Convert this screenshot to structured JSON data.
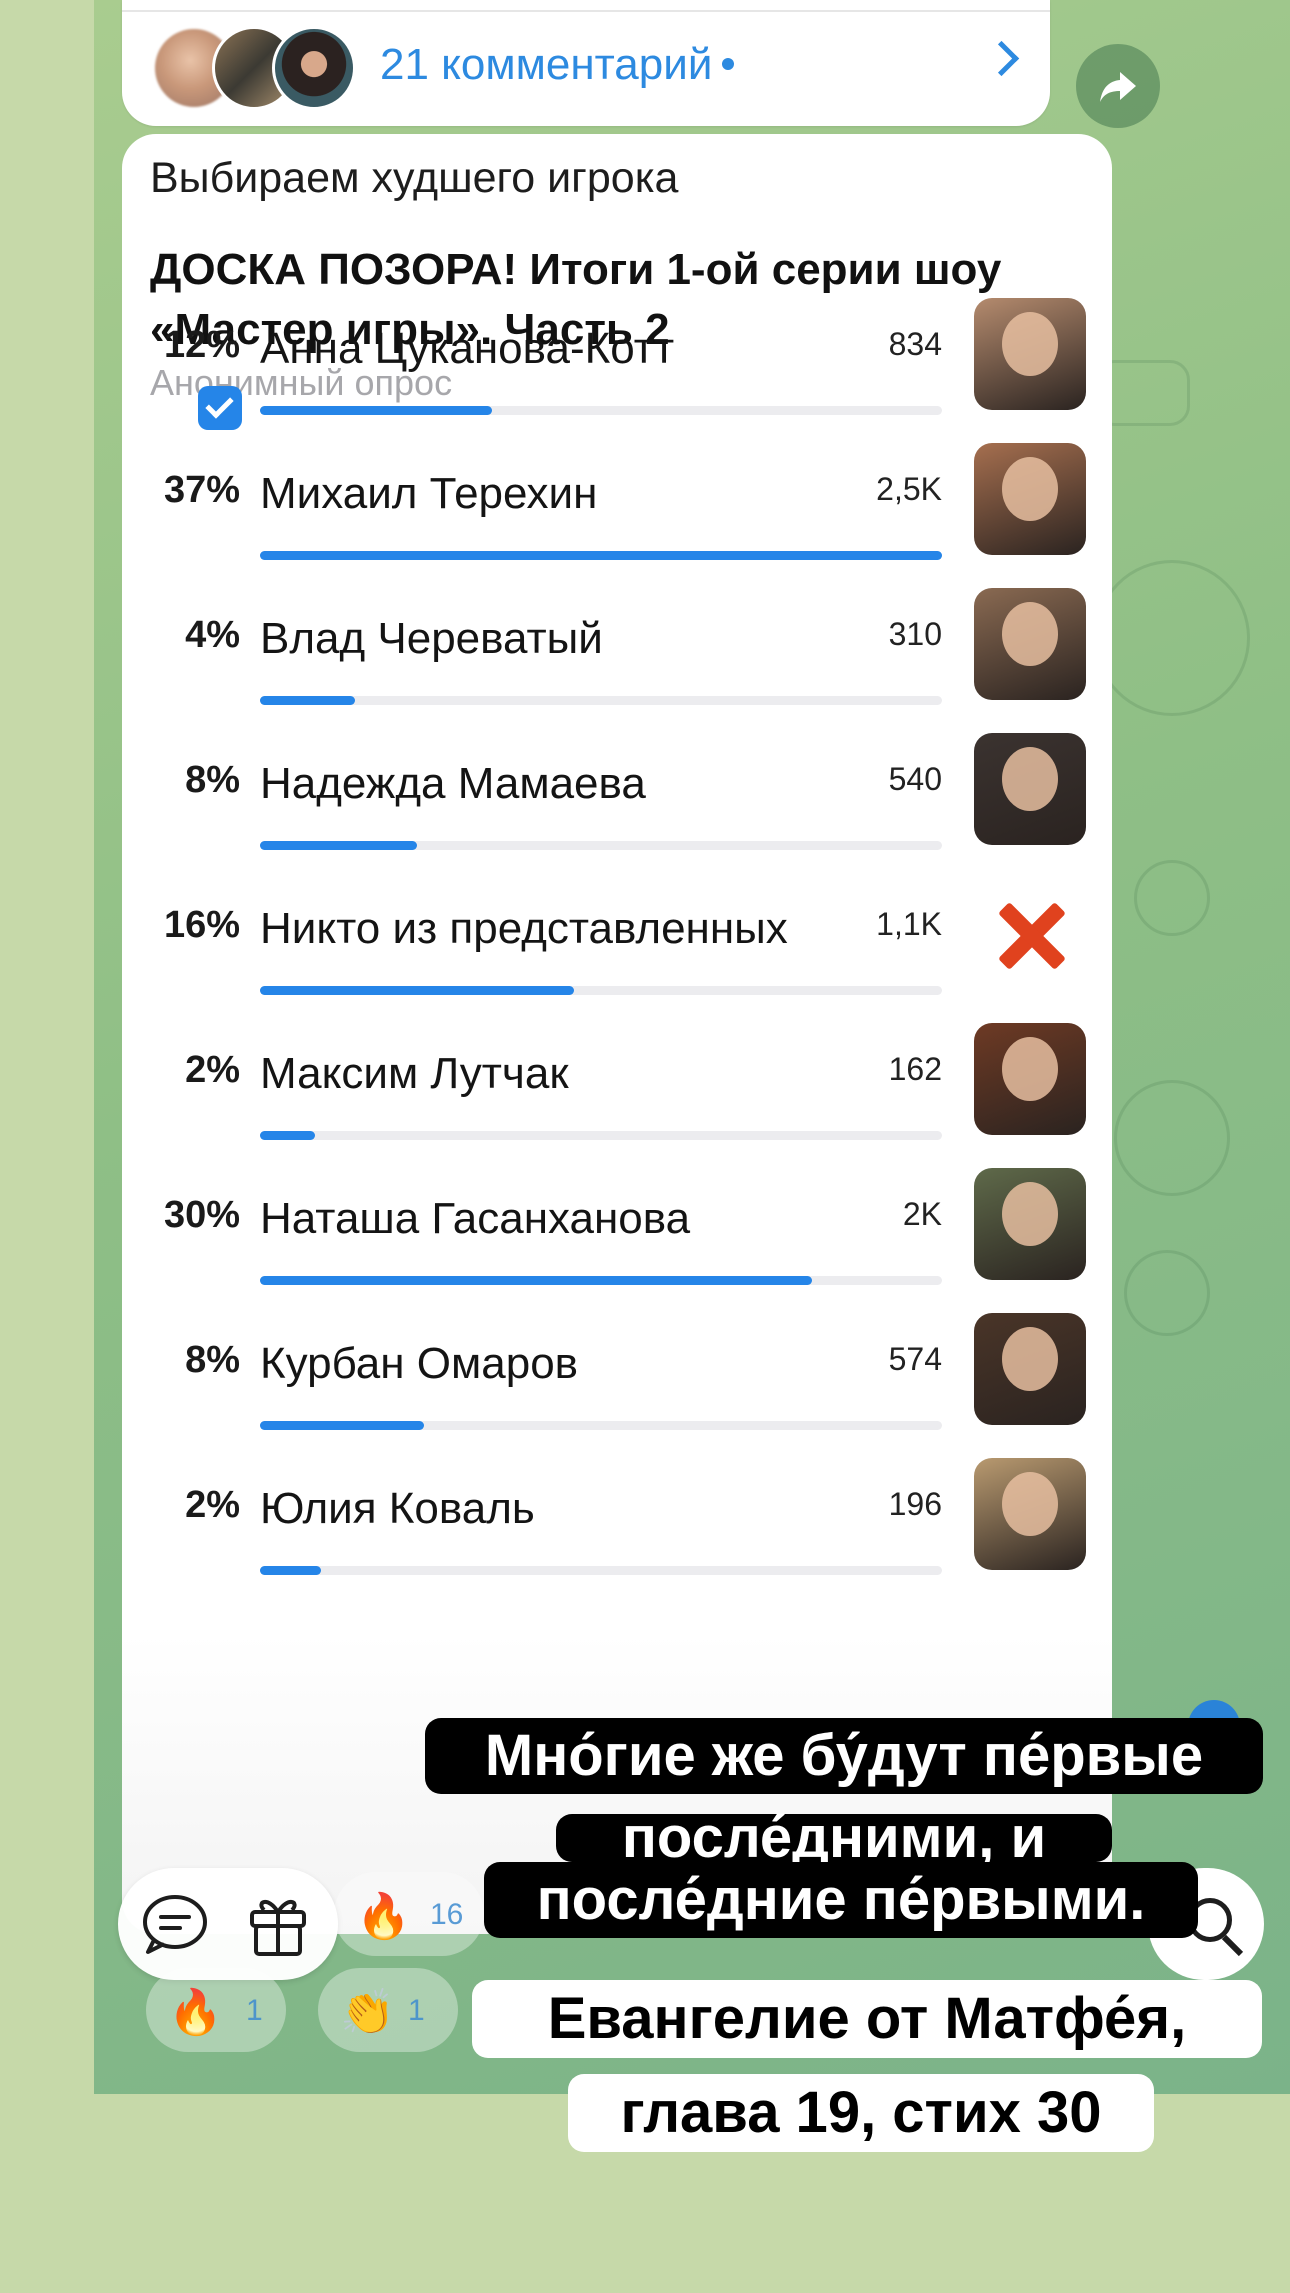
{
  "comments": {
    "count_label": "21 комментарий"
  },
  "poll": {
    "small_title": "Выбираем худшего игрока",
    "title": "ДОСКА ПОЗОРА! Итоги 1-ой серии шоу «Мастер игры». Часть 2",
    "type_label": "Анонимный опрос",
    "options": [
      {
        "percent": "12%",
        "name": "Анна Цуканова-Котт",
        "votes": "834",
        "fill": 0.34,
        "selected": true,
        "thumb": "photo",
        "color": "#b58b6e"
      },
      {
        "percent": "37%",
        "name": "Михаил Терехин",
        "votes": "2,5K",
        "fill": 1.0,
        "selected": false,
        "thumb": "photo",
        "color": "#a66f4f"
      },
      {
        "percent": "4%",
        "name": "Влад Череватый",
        "votes": "310",
        "fill": 0.14,
        "selected": false,
        "thumb": "photo",
        "color": "#8a6a52"
      },
      {
        "percent": "8%",
        "name": "Надежда Мамаева",
        "votes": "540",
        "fill": 0.23,
        "selected": false,
        "thumb": "photo",
        "color": "#3b3330"
      },
      {
        "percent": "16%",
        "name": "Никто из представленных",
        "votes": "1,1K",
        "fill": 0.46,
        "selected": false,
        "thumb": "x-mark",
        "color": "#e0421e"
      },
      {
        "percent": "2%",
        "name": "Максим Лутчак",
        "votes": "162",
        "fill": 0.08,
        "selected": false,
        "thumb": "photo",
        "color": "#6e3a24"
      },
      {
        "percent": "30%",
        "name": "Наташа Гасанханова",
        "votes": "2K",
        "fill": 0.81,
        "selected": false,
        "thumb": "photo",
        "color": "#5f6a4a"
      },
      {
        "percent": "8%",
        "name": "Курбан Омаров",
        "votes": "574",
        "fill": 0.24,
        "selected": false,
        "thumb": "photo",
        "color": "#4a3528"
      },
      {
        "percent": "2%",
        "name": "Юлия Коваль",
        "votes": "196",
        "fill": 0.09,
        "selected": false,
        "thumb": "photo",
        "color": "#b99a70"
      }
    ]
  },
  "reactions": [
    {
      "emoji": "🔥",
      "count": "16"
    },
    {
      "emoji": "🔥",
      "count": "1"
    },
    {
      "emoji": "👏",
      "count": "1"
    }
  ],
  "overlay": {
    "quote_lines": [
      "Мно́гие же бу́дут пе́рвые",
      "после́дними, и",
      "после́дние пе́рвыми."
    ],
    "reference_lines": [
      "Евангелие от Матфе́я,",
      "глава 19, стих 30"
    ]
  },
  "colors": {
    "accent": "#2585e8",
    "link": "#2d8ae0",
    "chat_bg": "#8fbf86",
    "page_bg": "#c6d9a9"
  }
}
